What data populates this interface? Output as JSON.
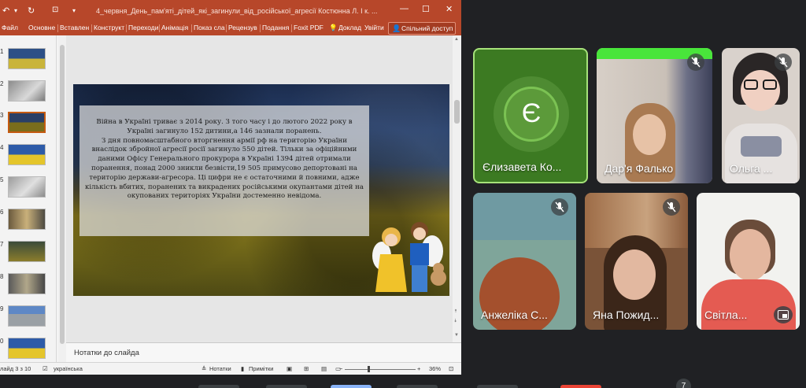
{
  "powerpoint": {
    "document_title": "4_червня_День_пам'яті_дітей_які_загинули_від_російської_агресії Костюнна Л. І к. ...",
    "tabs": [
      "Файл",
      "Основне",
      "Вставлен",
      "Конструкт",
      "Переходи",
      "Анімація",
      "Показ сла",
      "Рецензув",
      "Подання",
      "Foxit PDF",
      "Доклад",
      "Увійти"
    ],
    "share_label": "Спільний доступ",
    "thumbnail_numbers": [
      "1",
      "2",
      "3",
      "4",
      "5",
      "6",
      "7",
      "8",
      "9",
      "0"
    ],
    "selected_slide": "3",
    "slide": {
      "paragraphs": [
        "Війна в Україні триває з 2014 року. З того часу і до  лютого 2022 року в Україні загинуло 152 дитини,а 146 зазнали поранень.",
        "З дня повномасштабного вторгнення армії рф на територію України внаслідок збройної агресії росії загинуло 550 дітей. Тільки за офіційними даними Офісу Генерального прокурора в Україні 1394 дітей отримали поранення, понад 2000 зникли безвісти,19 505 примусово депортовані на територію держави-агресора. Ці цифри не є остаточними й повними, адже кількість вбитих, поранених та викрадених російськими окупантами дітей на окупованих територіях України достеменно невідома."
      ]
    },
    "notes_placeholder": "Нотатки до слайда",
    "status": {
      "slide_counter": "лайд 3 з 10",
      "language": "українська",
      "notes_button": "Нотатки",
      "comments_button": "Примітки",
      "zoom_minus": "−",
      "zoom_plus": "+",
      "zoom_level": "36%"
    }
  },
  "meet": {
    "participants": [
      {
        "name": "Єлизавета Ко...",
        "initial": "Є"
      },
      {
        "name": "Дар'я Фалько"
      },
      {
        "name": "Ольга ..."
      },
      {
        "name": "Анжеліка С..."
      },
      {
        "name": "Яна Пожид..."
      },
      {
        "name": "Світла..."
      }
    ],
    "badge_count": "7"
  },
  "colors": {
    "ppt_accent": "#b7472a",
    "meet_background": "#202124",
    "speaking_border": "#a6e27a"
  }
}
